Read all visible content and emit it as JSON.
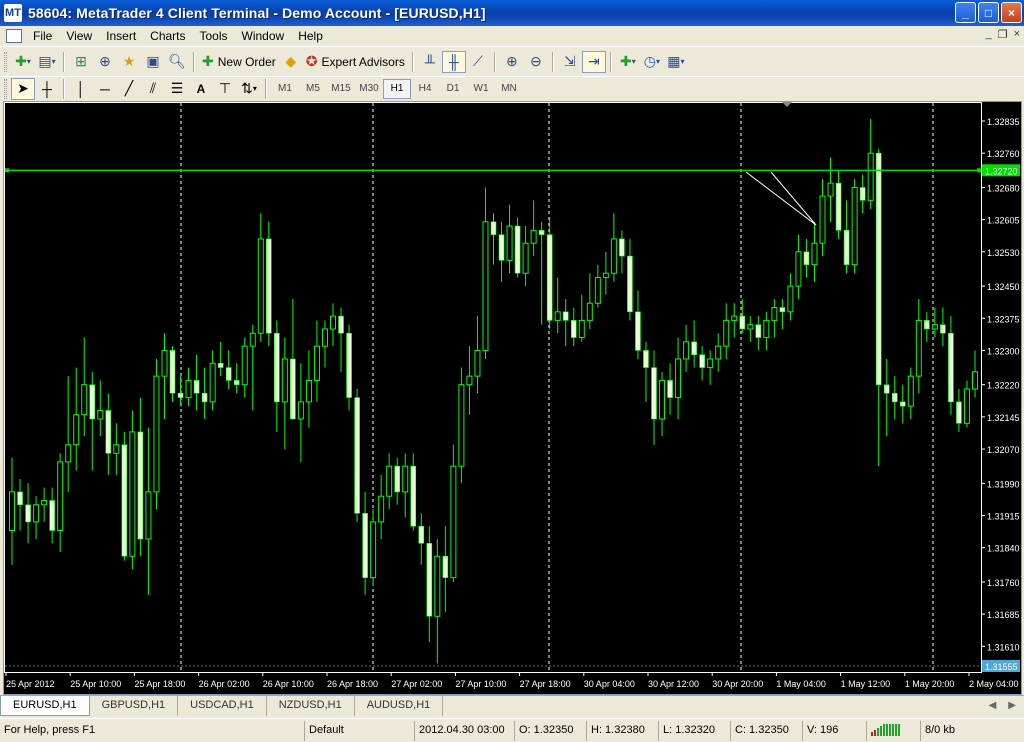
{
  "window": {
    "title": "58604: MetaTrader 4 Client Terminal - Demo Account - [EURUSD,H1]",
    "icon": "app-icon",
    "minimize": "_",
    "maximize": "□",
    "close": "×"
  },
  "menu": [
    {
      "label": "File",
      "key": "F"
    },
    {
      "label": "View",
      "key": "V"
    },
    {
      "label": "Insert",
      "key": "I"
    },
    {
      "label": "Charts",
      "key": "C"
    },
    {
      "label": "Tools",
      "key": "T"
    },
    {
      "label": "Window",
      "key": "W"
    },
    {
      "label": "Help",
      "key": "H"
    }
  ],
  "mdi": {
    "minimize": "_",
    "restore": "❐",
    "close": "×"
  },
  "toolbar": {
    "new_order_label": "New Order",
    "expert_advisors_label": "Expert Advisors"
  },
  "timeframes": [
    "M1",
    "M5",
    "M15",
    "M30",
    "H1",
    "H4",
    "D1",
    "W1",
    "MN"
  ],
  "active_timeframe": "H1",
  "chart_data": {
    "type": "candlestick",
    "symbol": "EURUSD",
    "timeframe": "H1",
    "background": "#000000",
    "bull_color": "#E8FFD8",
    "wick_color": "#00FF00",
    "grid_color": "#FFFFFF",
    "hline_color": "#00E000",
    "ylim": [
      1.3155,
      1.3287
    ],
    "y_ticks": [
      "1.32835",
      "1.32760",
      "1.32680",
      "1.32605",
      "1.32530",
      "1.32450",
      "1.32375",
      "1.32300",
      "1.32220",
      "1.32145",
      "1.32070",
      "1.31990",
      "1.31915",
      "1.31840",
      "1.31760",
      "1.31685",
      "1.31610"
    ],
    "x_ticks": [
      "25 Apr 2012",
      "25 Apr 10:00",
      "25 Apr 18:00",
      "26 Apr 02:00",
      "26 Apr 10:00",
      "26 Apr 18:00",
      "27 Apr 02:00",
      "27 Apr 10:00",
      "27 Apr 18:00",
      "30 Apr 04:00",
      "30 Apr 12:00",
      "30 Apr 20:00",
      "1 May 04:00",
      "1 May 12:00",
      "1 May 20:00",
      "2 May 04:00"
    ],
    "horizontal_line": "1.32720",
    "bid_label": "1.31555",
    "candles": [
      [
        1.3188,
        1.3205,
        1.318,
        1.3197
      ],
      [
        1.3197,
        1.32,
        1.3188,
        1.3194
      ],
      [
        1.3194,
        1.3199,
        1.3185,
        1.319
      ],
      [
        1.319,
        1.3196,
        1.3186,
        1.3194
      ],
      [
        1.3194,
        1.3198,
        1.319,
        1.3195
      ],
      [
        1.3195,
        1.3198,
        1.3185,
        1.3188
      ],
      [
        1.3188,
        1.3206,
        1.3183,
        1.3204
      ],
      [
        1.3204,
        1.3224,
        1.3197,
        1.3208
      ],
      [
        1.3208,
        1.3226,
        1.3202,
        1.3215
      ],
      [
        1.3215,
        1.3233,
        1.321,
        1.3222
      ],
      [
        1.3222,
        1.3225,
        1.3202,
        1.3214
      ],
      [
        1.3214,
        1.3223,
        1.321,
        1.3216
      ],
      [
        1.3216,
        1.322,
        1.3201,
        1.3206
      ],
      [
        1.3206,
        1.3213,
        1.3201,
        1.3208
      ],
      [
        1.3208,
        1.3211,
        1.3181,
        1.3182
      ],
      [
        1.3182,
        1.3216,
        1.3179,
        1.3211
      ],
      [
        1.3211,
        1.3219,
        1.3182,
        1.3186
      ],
      [
        1.3186,
        1.3212,
        1.3173,
        1.3197
      ],
      [
        1.3197,
        1.3228,
        1.3193,
        1.3224
      ],
      [
        1.3224,
        1.3234,
        1.3214,
        1.323
      ],
      [
        1.323,
        1.3231,
        1.3218,
        1.322
      ],
      [
        1.322,
        1.3224,
        1.3217,
        1.3219
      ],
      [
        1.3219,
        1.3226,
        1.3217,
        1.3223
      ],
      [
        1.3223,
        1.3229,
        1.3216,
        1.322
      ],
      [
        1.322,
        1.3226,
        1.3214,
        1.3218
      ],
      [
        1.3218,
        1.323,
        1.3216,
        1.3227
      ],
      [
        1.3227,
        1.3232,
        1.3224,
        1.3226
      ],
      [
        1.3226,
        1.323,
        1.3221,
        1.3223
      ],
      [
        1.3223,
        1.3227,
        1.322,
        1.3222
      ],
      [
        1.3222,
        1.3233,
        1.3219,
        1.3231
      ],
      [
        1.3231,
        1.3236,
        1.3216,
        1.3234
      ],
      [
        1.3234,
        1.3262,
        1.3232,
        1.3256
      ],
      [
        1.3256,
        1.326,
        1.3231,
        1.3234
      ],
      [
        1.3234,
        1.3237,
        1.3211,
        1.3218
      ],
      [
        1.3218,
        1.3233,
        1.3207,
        1.3228
      ],
      [
        1.3228,
        1.3242,
        1.3215,
        1.3214
      ],
      [
        1.3214,
        1.3227,
        1.3204,
        1.3218
      ],
      [
        1.3218,
        1.323,
        1.3212,
        1.3223
      ],
      [
        1.3223,
        1.3237,
        1.3218,
        1.3231
      ],
      [
        1.3231,
        1.3237,
        1.3226,
        1.3235
      ],
      [
        1.3235,
        1.3241,
        1.3231,
        1.3238
      ],
      [
        1.3238,
        1.324,
        1.3225,
        1.3234
      ],
      [
        1.3234,
        1.3236,
        1.3216,
        1.3219
      ],
      [
        1.3219,
        1.3221,
        1.319,
        1.3192
      ],
      [
        1.3192,
        1.3197,
        1.3173,
        1.3177
      ],
      [
        1.3177,
        1.3193,
        1.3175,
        1.319
      ],
      [
        1.319,
        1.3201,
        1.3186,
        1.3196
      ],
      [
        1.3196,
        1.3206,
        1.3193,
        1.3203
      ],
      [
        1.3203,
        1.3205,
        1.3194,
        1.3197
      ],
      [
        1.3197,
        1.3206,
        1.3191,
        1.3203
      ],
      [
        1.3203,
        1.3206,
        1.3188,
        1.3189
      ],
      [
        1.3189,
        1.3192,
        1.318,
        1.3185
      ],
      [
        1.3185,
        1.3189,
        1.3162,
        1.3168
      ],
      [
        1.3168,
        1.3186,
        1.3157,
        1.3182
      ],
      [
        1.3182,
        1.3189,
        1.3169,
        1.3177
      ],
      [
        1.3177,
        1.3208,
        1.3176,
        1.3203
      ],
      [
        1.3203,
        1.3226,
        1.3199,
        1.3222
      ],
      [
        1.3222,
        1.3231,
        1.3215,
        1.3224
      ],
      [
        1.3224,
        1.3238,
        1.322,
        1.323
      ],
      [
        1.323,
        1.3268,
        1.3228,
        1.326
      ],
      [
        1.326,
        1.3262,
        1.325,
        1.3257
      ],
      [
        1.3257,
        1.326,
        1.3246,
        1.3251
      ],
      [
        1.3251,
        1.3264,
        1.3248,
        1.3259
      ],
      [
        1.3259,
        1.3261,
        1.3247,
        1.3248
      ],
      [
        1.3248,
        1.3259,
        1.3245,
        1.3255
      ],
      [
        1.3255,
        1.3265,
        1.3252,
        1.3258
      ],
      [
        1.3258,
        1.326,
        1.3236,
        1.3257
      ],
      [
        1.3257,
        1.3261,
        1.3235,
        1.3237
      ],
      [
        1.3237,
        1.3247,
        1.3234,
        1.3239
      ],
      [
        1.3239,
        1.3242,
        1.3231,
        1.3237
      ],
      [
        1.3237,
        1.324,
        1.3231,
        1.3233
      ],
      [
        1.3233,
        1.3243,
        1.3232,
        1.3237
      ],
      [
        1.3237,
        1.3248,
        1.3235,
        1.3241
      ],
      [
        1.3241,
        1.325,
        1.324,
        1.3247
      ],
      [
        1.3247,
        1.3253,
        1.3243,
        1.3248
      ],
      [
        1.3248,
        1.3262,
        1.3246,
        1.3256
      ],
      [
        1.3256,
        1.3258,
        1.3248,
        1.3252
      ],
      [
        1.3252,
        1.3256,
        1.3237,
        1.3239
      ],
      [
        1.3239,
        1.3244,
        1.3228,
        1.323
      ],
      [
        1.323,
        1.3232,
        1.3218,
        1.3226
      ],
      [
        1.3226,
        1.323,
        1.3208,
        1.3214
      ],
      [
        1.3214,
        1.3225,
        1.321,
        1.3223
      ],
      [
        1.3223,
        1.3227,
        1.3215,
        1.3219
      ],
      [
        1.3219,
        1.3233,
        1.3214,
        1.3228
      ],
      [
        1.3228,
        1.3236,
        1.3225,
        1.3232
      ],
      [
        1.3232,
        1.3237,
        1.3226,
        1.3229
      ],
      [
        1.3229,
        1.3231,
        1.3223,
        1.3226
      ],
      [
        1.3226,
        1.323,
        1.3222,
        1.3228
      ],
      [
        1.3228,
        1.3234,
        1.3225,
        1.3231
      ],
      [
        1.3231,
        1.3241,
        1.3228,
        1.3237
      ],
      [
        1.3237,
        1.3241,
        1.3233,
        1.3238
      ],
      [
        1.3238,
        1.3242,
        1.3234,
        1.3235
      ],
      [
        1.3235,
        1.3238,
        1.3232,
        1.3236
      ],
      [
        1.3236,
        1.3238,
        1.323,
        1.3233
      ],
      [
        1.3233,
        1.3239,
        1.323,
        1.3237
      ],
      [
        1.3237,
        1.3242,
        1.3233,
        1.324
      ],
      [
        1.324,
        1.3242,
        1.3235,
        1.3239
      ],
      [
        1.3239,
        1.3248,
        1.3237,
        1.3245
      ],
      [
        1.3245,
        1.3257,
        1.3242,
        1.3253
      ],
      [
        1.3253,
        1.3256,
        1.3247,
        1.325
      ],
      [
        1.325,
        1.326,
        1.3246,
        1.3255
      ],
      [
        1.3255,
        1.327,
        1.3252,
        1.3266
      ],
      [
        1.3266,
        1.3275,
        1.326,
        1.3269
      ],
      [
        1.3269,
        1.3272,
        1.3256,
        1.3258
      ],
      [
        1.3258,
        1.3265,
        1.3248,
        1.325
      ],
      [
        1.325,
        1.327,
        1.3248,
        1.3268
      ],
      [
        1.3268,
        1.3271,
        1.3262,
        1.3265
      ],
      [
        1.3265,
        1.3284,
        1.3263,
        1.3276
      ],
      [
        1.3276,
        1.3277,
        1.3203,
        1.3222
      ],
      [
        1.3222,
        1.3228,
        1.321,
        1.322
      ],
      [
        1.322,
        1.3224,
        1.3214,
        1.3218
      ],
      [
        1.3218,
        1.3222,
        1.3213,
        1.3217
      ],
      [
        1.3217,
        1.3226,
        1.3214,
        1.3224
      ],
      [
        1.3224,
        1.3242,
        1.322,
        1.3237
      ],
      [
        1.3237,
        1.3239,
        1.3232,
        1.3235
      ],
      [
        1.3235,
        1.324,
        1.3233,
        1.3236
      ],
      [
        1.3236,
        1.324,
        1.3231,
        1.3234
      ],
      [
        1.3234,
        1.3238,
        1.3215,
        1.3218
      ],
      [
        1.3218,
        1.3221,
        1.3211,
        1.3213
      ],
      [
        1.3213,
        1.3223,
        1.3212,
        1.3221
      ],
      [
        1.3221,
        1.323,
        1.3219,
        1.3225
      ]
    ]
  },
  "tabs": [
    "EURUSD,H1",
    "GBPUSD,H1",
    "USDCAD,H1",
    "NZDUSD,H1",
    "AUDUSD,H1"
  ],
  "active_tab": "EURUSD,H1",
  "tab_nav": {
    "prev": "◀",
    "next": "▶"
  },
  "status": {
    "help": "For Help, press F1",
    "profile": "Default",
    "datetime": "2012.04.30 03:00",
    "open": "O: 1.32350",
    "high": "H: 1.32380",
    "low": "L: 1.32320",
    "close": "C: 1.32350",
    "volume": "V: 196",
    "traffic": "8/0 kb"
  }
}
